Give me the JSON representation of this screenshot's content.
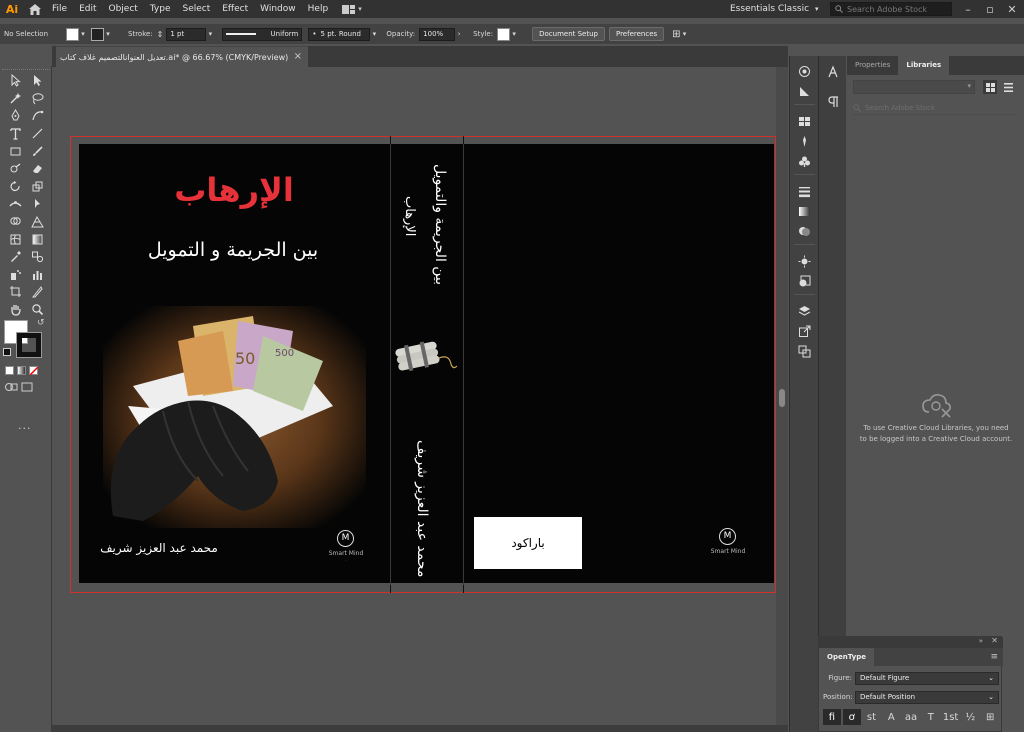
{
  "app": {
    "logo": "Ai"
  },
  "menu": [
    "File",
    "Edit",
    "Object",
    "Type",
    "Select",
    "Effect",
    "Window",
    "Help"
  ],
  "workspace": {
    "label": "Essentials Classic"
  },
  "stock_search": {
    "placeholder": "Search Adobe Stock"
  },
  "control_bar": {
    "selection": "No Selection",
    "stroke_label": "Stroke:",
    "stroke_weight": "1 pt",
    "profile": "Uniform",
    "brush": "5 pt. Round",
    "opacity_label": "Opacity:",
    "opacity": "100%",
    "style_label": "Style:",
    "document_setup": "Document Setup",
    "preferences": "Preferences"
  },
  "document": {
    "tab_title": "تعديل العنوانالتصميم غلاف كتاب.ai* @ 66.67% (CMYK/Preview)"
  },
  "cover": {
    "title": "الإرهاب",
    "subtitle": "بين الجريمة و التمويل",
    "author": "محمد عبد العزيز شريف",
    "spine_title_1": "الإرهاب",
    "spine_title_2": "بين الجريمة والتمويل",
    "spine_author": "محمد عبد العزيز شريف",
    "barcode": "باراكود",
    "logo_mark": "M",
    "logo_name": "Smart Mind"
  },
  "panels": {
    "tabs": [
      "Properties",
      "Libraries"
    ],
    "active_tab": "Libraries",
    "library_search": "Search Adobe Stock",
    "libraries_message": "To use Creative Cloud Libraries, you need to be logged into a Creative Cloud account."
  },
  "opentype": {
    "title": "OpenType",
    "figure_label": "Figure:",
    "figure_value": "Default Figure",
    "position_label": "Position:",
    "position_value": "Default Position",
    "glyphs": [
      "fi",
      "ơ",
      "st",
      "A",
      "aa",
      "T",
      "1st",
      "½",
      "⊞"
    ]
  },
  "colors": {
    "accent": "#ff9a00",
    "title_red": "#e8323a",
    "bleed": "#d0312d"
  }
}
